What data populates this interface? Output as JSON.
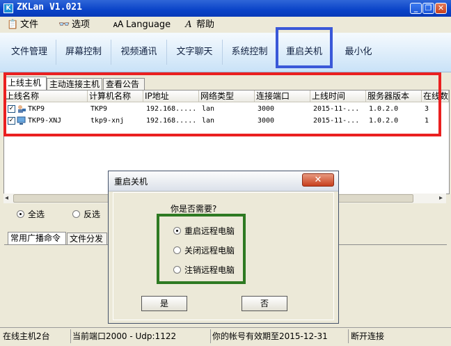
{
  "window": {
    "title": "ZKLan V1.021",
    "app_icon": "K",
    "min": "_",
    "restore": "❐",
    "close": "✕"
  },
  "menu": [
    {
      "label": "文件",
      "icon": "file-icon",
      "glyph": "📋"
    },
    {
      "label": "选项",
      "icon": "glasses-icon",
      "glyph": "👓"
    },
    {
      "label": "Language",
      "icon": "language-icon",
      "glyph": "🗚"
    },
    {
      "label": "帮助",
      "icon": "help-icon",
      "glyph": "A"
    }
  ],
  "toolbar": [
    "文件管理",
    "屏幕控制",
    "视频通讯",
    "文字聊天",
    "系统控制",
    "重启关机",
    "最小化"
  ],
  "tabs": [
    "上线主机",
    "主动连接主机",
    "查看公告"
  ],
  "table": {
    "headers": [
      "上线名称",
      "计算机名称",
      "IP地址",
      "网络类型",
      "连接端口",
      "上线时间",
      "服务器版本",
      "在线数"
    ],
    "rows": [
      {
        "name": "TKP9",
        "computer": "TKP9",
        "ip": "192.168.....",
        "type": "lan",
        "port": "3000",
        "time": "2015-11-...",
        "version": "1.0.2.0",
        "online": "3",
        "checked": "✓",
        "icon": "user-computer-icon"
      },
      {
        "name": "TKP9-XNJ",
        "computer": "tkp9-xnj",
        "ip": "192.168.....",
        "type": "lan",
        "port": "3000",
        "time": "2015-11-...",
        "version": "1.0.2.0",
        "online": "1",
        "checked": "✓",
        "icon": "computer-icon"
      }
    ]
  },
  "scroll": {
    "left": "◂",
    "right": "▸"
  },
  "selection": {
    "all": "全选",
    "invert": "反选"
  },
  "bottom_tabs": [
    "常用广播命令",
    "文件分发"
  ],
  "dialog": {
    "title": "重启关机",
    "close": "✕",
    "question": "你是否需要?",
    "options": [
      "重启远程电脑",
      "关闭远程电脑",
      "注销远程电脑"
    ],
    "selected_index": 0,
    "yes": "是",
    "no": "否"
  },
  "status": [
    "在线主机2台",
    "当前端口2000 - Udp:1122",
    "你的帐号有效期至2015-12-31",
    "断开连接"
  ],
  "colors": {
    "red_box": "#ea2020",
    "blue_box": "#3a58d8",
    "green_box": "#2e7a22"
  }
}
